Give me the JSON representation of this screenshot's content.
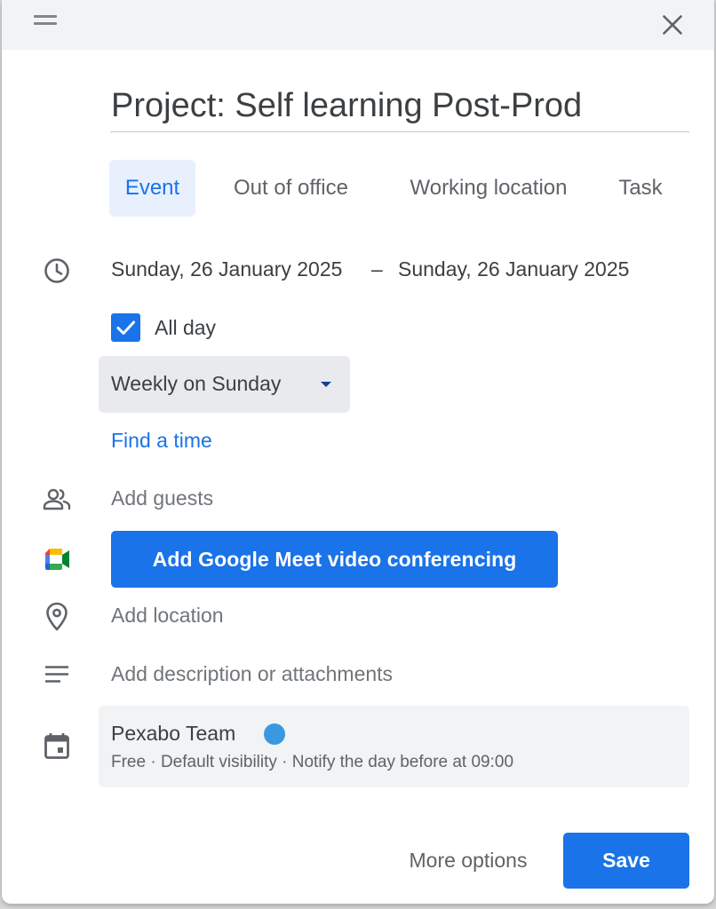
{
  "colors": {
    "accent": "#1a73e8",
    "accent_light": "#e8f0fe",
    "calendar_dot": "#3a98e0"
  },
  "title": {
    "value": "Project: Self learning Post-Prod"
  },
  "tabs": [
    {
      "label": "Event",
      "active": true
    },
    {
      "label": "Out of office",
      "active": false
    },
    {
      "label": "Working location",
      "active": false
    },
    {
      "label": "Task",
      "active": false
    }
  ],
  "datetime": {
    "start": "Sunday, 26 January 2025",
    "separator": "–",
    "end": "Sunday, 26 January 2025",
    "all_day_label": "All day",
    "all_day_checked": true
  },
  "recurrence": {
    "selected": "Weekly on Sunday"
  },
  "find_time": "Find a time",
  "guests": {
    "placeholder": "Add guests"
  },
  "meet": {
    "label": "Add Google Meet video conferencing"
  },
  "location": {
    "placeholder": "Add location"
  },
  "description": {
    "placeholder": "Add description or attachments"
  },
  "calendar": {
    "name": "Pexabo Team",
    "details": "Free · Default visibility · Notify the day before at 09:00"
  },
  "footer": {
    "more_options": "More options",
    "save": "Save"
  },
  "icons": {
    "drag": "drag-handle-icon",
    "close": "close-icon",
    "time": "clock-icon",
    "guests": "people-icon",
    "meet": "google-meet-icon",
    "location": "location-pin-icon",
    "description": "notes-icon",
    "calendar": "calendar-icon"
  }
}
